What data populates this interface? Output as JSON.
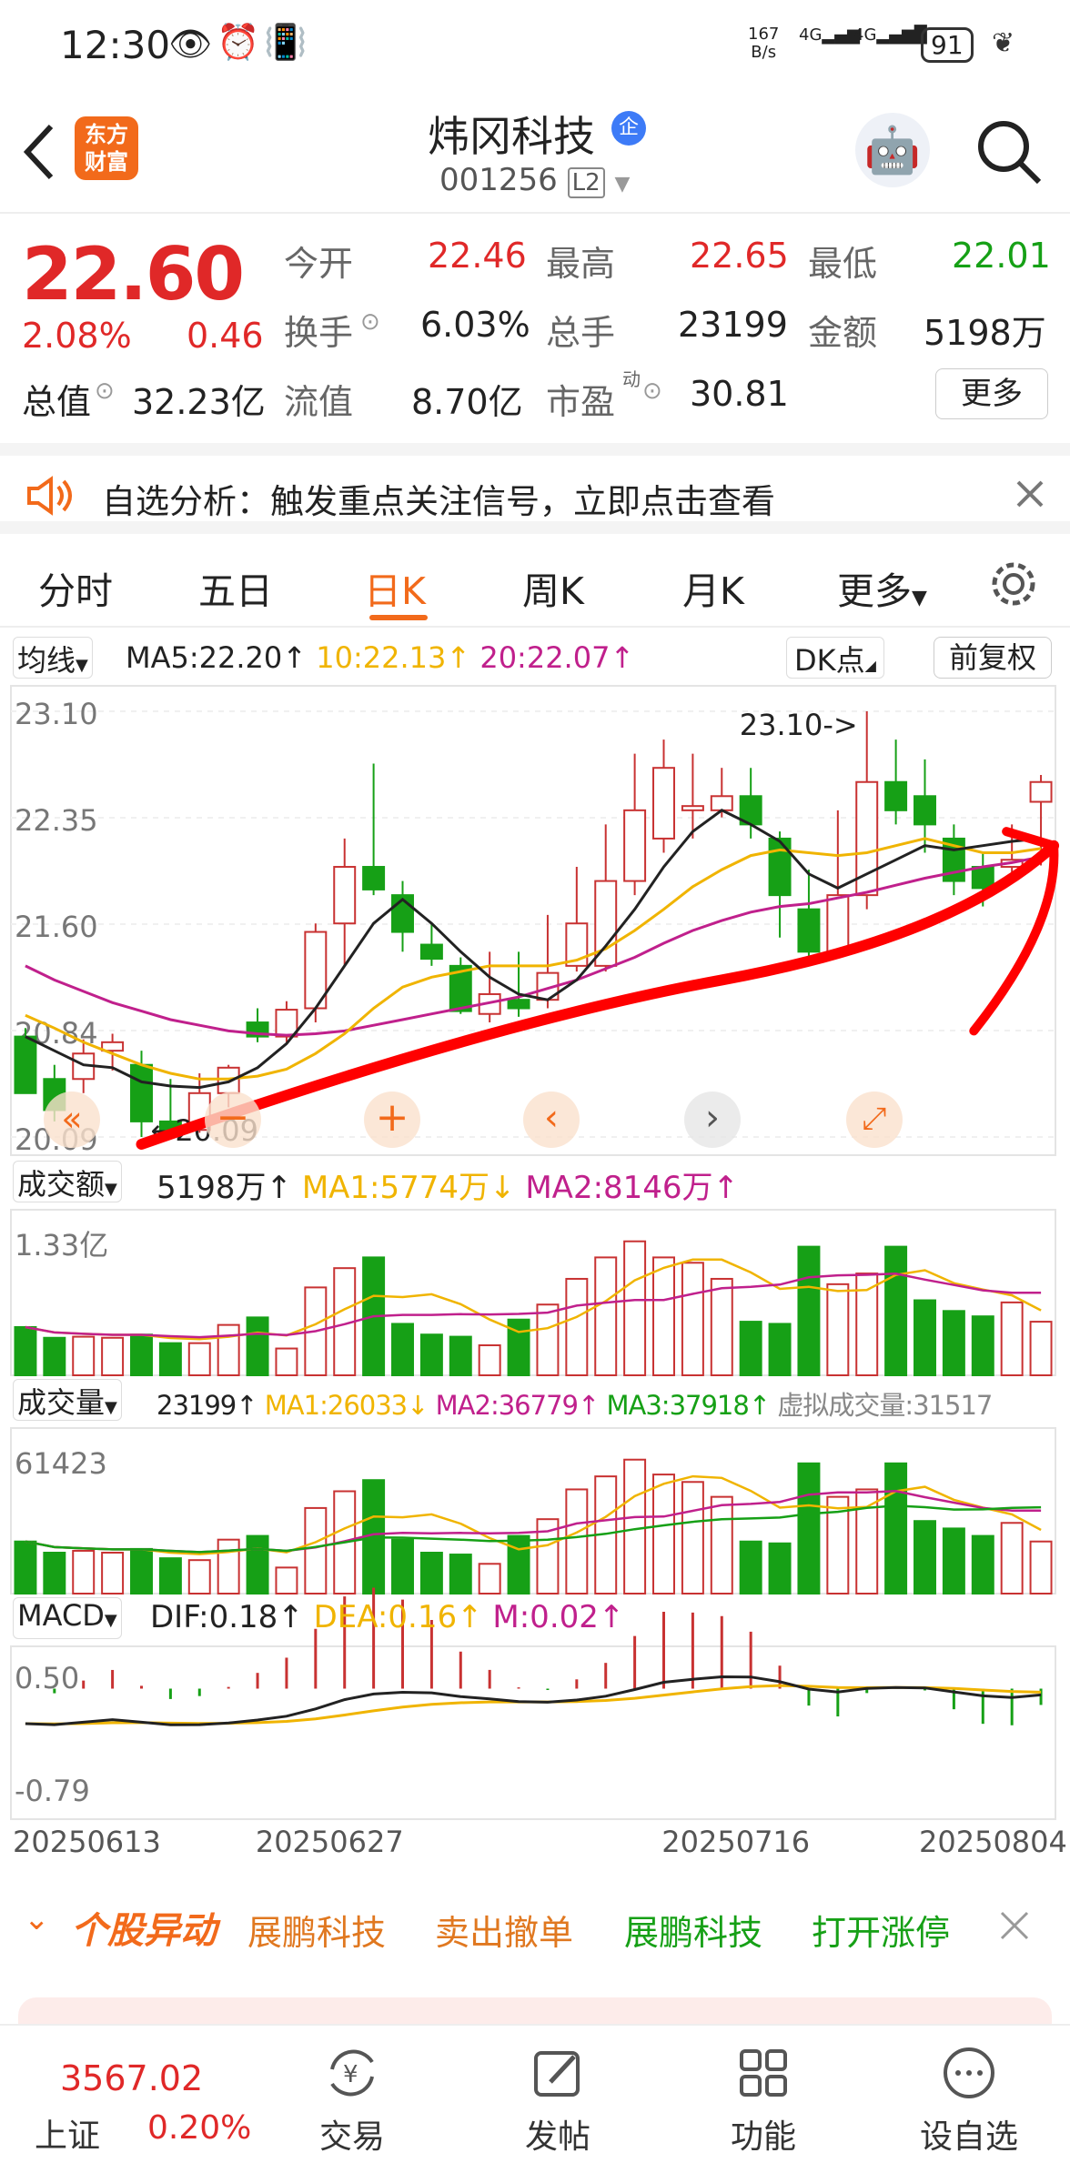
{
  "status": {
    "time": "12:30",
    "net_speed": "167\nB/s",
    "net1": "4G",
    "net2": "4G",
    "battery": "91"
  },
  "header": {
    "name": "炜冈科技",
    "code": "001256",
    "level": "L2",
    "enterprise_badge": "企",
    "logo_line1": "东方",
    "logo_line2": "财富"
  },
  "quote": {
    "price": "22.60",
    "change_pct": "2.08%",
    "change": "0.46",
    "open_label": "今开",
    "open": "22.46",
    "high_label": "最高",
    "high": "22.65",
    "low_label": "最低",
    "low": "22.01",
    "turnover_label": "换手",
    "turnover": "6.03%",
    "volume_label": "总手",
    "volume": "23199",
    "amount_label": "金额",
    "amount": "5198万",
    "mcap_label": "总值",
    "mcap": "32.23亿",
    "float_label": "流值",
    "float": "8.70亿",
    "pe_label": "市盈",
    "pe_sup": "动",
    "pe": "30.81",
    "more": "更多"
  },
  "notice": {
    "text": "自选分析：触发重点关注信号，立即点击查看"
  },
  "tabs": {
    "items": [
      "分时",
      "五日",
      "日K",
      "周K",
      "月K",
      "更多"
    ],
    "active": 2
  },
  "kline": {
    "indicator": "均线",
    "ma5": "MA5:22.20↑",
    "ma10": "10:22.13↑",
    "ma20": "20:22.07↑",
    "dk": "DK点",
    "fq": "前复权",
    "y_labels": [
      "23.10",
      "22.35",
      "21.60",
      "20.84",
      "20.09"
    ],
    "max_label": "23.10->",
    "min_label": "20.09"
  },
  "amount_panel": {
    "name": "成交额",
    "value": "5198万↑",
    "ma1": "MA1:5774万↓",
    "ma2": "MA2:8146万↑",
    "ytop": "1.33亿"
  },
  "vol_panel": {
    "name": "成交量",
    "value": "23199↑",
    "ma1": "MA1:26033↓",
    "ma2": "MA2:36779↑",
    "ma3": "MA3:37918↑",
    "virtual": "虚拟成交量:31517",
    "ytop": "61423"
  },
  "macd_panel": {
    "name": "MACD",
    "dif": "DIF:0.18↑",
    "dea": "DEA:0.16↑",
    "m": "M:0.02↑",
    "ytop": "0.50",
    "ybot": "-0.79"
  },
  "x_dates": [
    "20250613",
    "20250627",
    "20250716",
    "20250804"
  ],
  "alert": {
    "title": "个股异动",
    "items": [
      "展鹏科技",
      "卖出撤单",
      "展鹏科技",
      "打开涨停"
    ]
  },
  "bottomnav": {
    "index_value": "3567.02",
    "index_name": "上证",
    "index_change": "0.20%",
    "items": [
      "交易",
      "发帖",
      "功能",
      "设自选"
    ]
  },
  "colors": {
    "up": "#c83232",
    "down": "#16a016",
    "ma5": "#222222",
    "ma10": "#f0b400",
    "ma20": "#c0208c",
    "accent": "#f26a1b"
  },
  "chart_data": {
    "type": "candlestick",
    "candles": [
      [
        20.8,
        20.4,
        20.86,
        20.4
      ],
      [
        20.5,
        20.28,
        20.6,
        20.2
      ],
      [
        20.5,
        20.68,
        20.78,
        20.4
      ],
      [
        20.7,
        20.76,
        20.82,
        20.56
      ],
      [
        20.6,
        20.2,
        20.7,
        20.09
      ],
      [
        20.2,
        20.12,
        20.5,
        20.09
      ],
      [
        20.14,
        20.4,
        20.54,
        20.12
      ],
      [
        20.4,
        20.58,
        20.6,
        20.3
      ],
      [
        20.9,
        20.8,
        21.0,
        20.76
      ],
      [
        20.8,
        20.99,
        21.05,
        20.76
      ],
      [
        21.0,
        21.54,
        21.6,
        20.9
      ],
      [
        21.6,
        22.0,
        22.2,
        21.3
      ],
      [
        22.0,
        21.84,
        22.73,
        21.8
      ],
      [
        21.8,
        21.54,
        21.9,
        21.4
      ],
      [
        21.45,
        21.35,
        21.6,
        21.3
      ],
      [
        21.3,
        20.98,
        21.36,
        20.96
      ],
      [
        20.96,
        21.1,
        21.4,
        20.9
      ],
      [
        21.06,
        21.0,
        21.4,
        20.94
      ],
      [
        21.06,
        21.25,
        21.66,
        21.0
      ],
      [
        21.3,
        21.6,
        22.0,
        21.26
      ],
      [
        21.3,
        21.9,
        22.3,
        21.26
      ],
      [
        21.9,
        22.4,
        22.8,
        21.8
      ],
      [
        22.2,
        22.7,
        22.9,
        22.1
      ],
      [
        22.4,
        22.43,
        22.8,
        22.2
      ],
      [
        22.4,
        22.5,
        22.7,
        22.35
      ],
      [
        22.5,
        22.3,
        22.7,
        22.2
      ],
      [
        22.2,
        21.8,
        22.25,
        21.5
      ],
      [
        21.7,
        21.4,
        21.98,
        21.3
      ],
      [
        21.4,
        21.8,
        22.4,
        21.4
      ],
      [
        21.8,
        22.6,
        23.1,
        21.7
      ],
      [
        22.6,
        22.4,
        22.9,
        22.3
      ],
      [
        22.5,
        22.3,
        22.76,
        22.1
      ],
      [
        22.2,
        21.9,
        22.3,
        21.8
      ],
      [
        22.0,
        21.85,
        22.1,
        21.72
      ],
      [
        22.0,
        22.05,
        22.3,
        21.9
      ],
      [
        22.46,
        22.6,
        22.65,
        22.01
      ]
    ],
    "ma5": [
      20.8,
      20.7,
      20.6,
      20.58,
      20.48,
      20.45,
      20.44,
      20.48,
      20.58,
      20.75,
      21.0,
      21.3,
      21.6,
      21.77,
      21.6,
      21.4,
      21.22,
      21.1,
      21.06,
      21.2,
      21.44,
      21.7,
      22.0,
      22.25,
      22.4,
      22.3,
      22.18,
      21.95,
      21.85,
      21.95,
      22.05,
      22.15,
      22.12,
      22.15,
      22.18,
      22.2
    ],
    "ma10": [
      20.95,
      20.86,
      20.76,
      20.68,
      20.6,
      20.54,
      20.5,
      20.5,
      20.52,
      20.57,
      20.68,
      20.82,
      21.0,
      21.15,
      21.22,
      21.26,
      21.3,
      21.3,
      21.3,
      21.34,
      21.42,
      21.55,
      21.7,
      21.86,
      21.98,
      22.08,
      22.12,
      22.1,
      22.08,
      22.1,
      22.15,
      22.2,
      22.15,
      22.1,
      22.1,
      22.13
    ],
    "ma20": [
      21.3,
      21.2,
      21.12,
      21.04,
      20.98,
      20.92,
      20.88,
      20.84,
      20.82,
      20.81,
      20.82,
      20.84,
      20.88,
      20.92,
      20.96,
      21.0,
      21.04,
      21.08,
      21.14,
      21.2,
      21.28,
      21.36,
      21.46,
      21.55,
      21.62,
      21.68,
      21.72,
      21.74,
      21.78,
      21.82,
      21.87,
      21.92,
      21.96,
      22.0,
      22.03,
      22.07
    ],
    "amount": [
      45,
      35,
      36,
      35,
      38,
      30,
      30,
      47,
      54,
      25,
      82,
      100,
      110,
      48,
      38,
      36,
      28,
      52,
      66,
      90,
      110,
      125,
      110,
      105,
      90,
      50,
      48,
      120,
      85,
      95,
      120,
      70,
      60,
      55,
      68,
      50
    ],
    "volume": [
      28,
      22,
      23,
      22,
      24,
      19,
      18,
      29,
      31,
      14,
      46,
      55,
      61,
      29,
      22,
      21,
      16,
      31,
      40,
      56,
      63,
      72,
      64,
      60,
      52,
      28,
      27,
      70,
      52,
      56,
      70,
      39,
      35,
      31,
      38,
      28
    ]
  }
}
